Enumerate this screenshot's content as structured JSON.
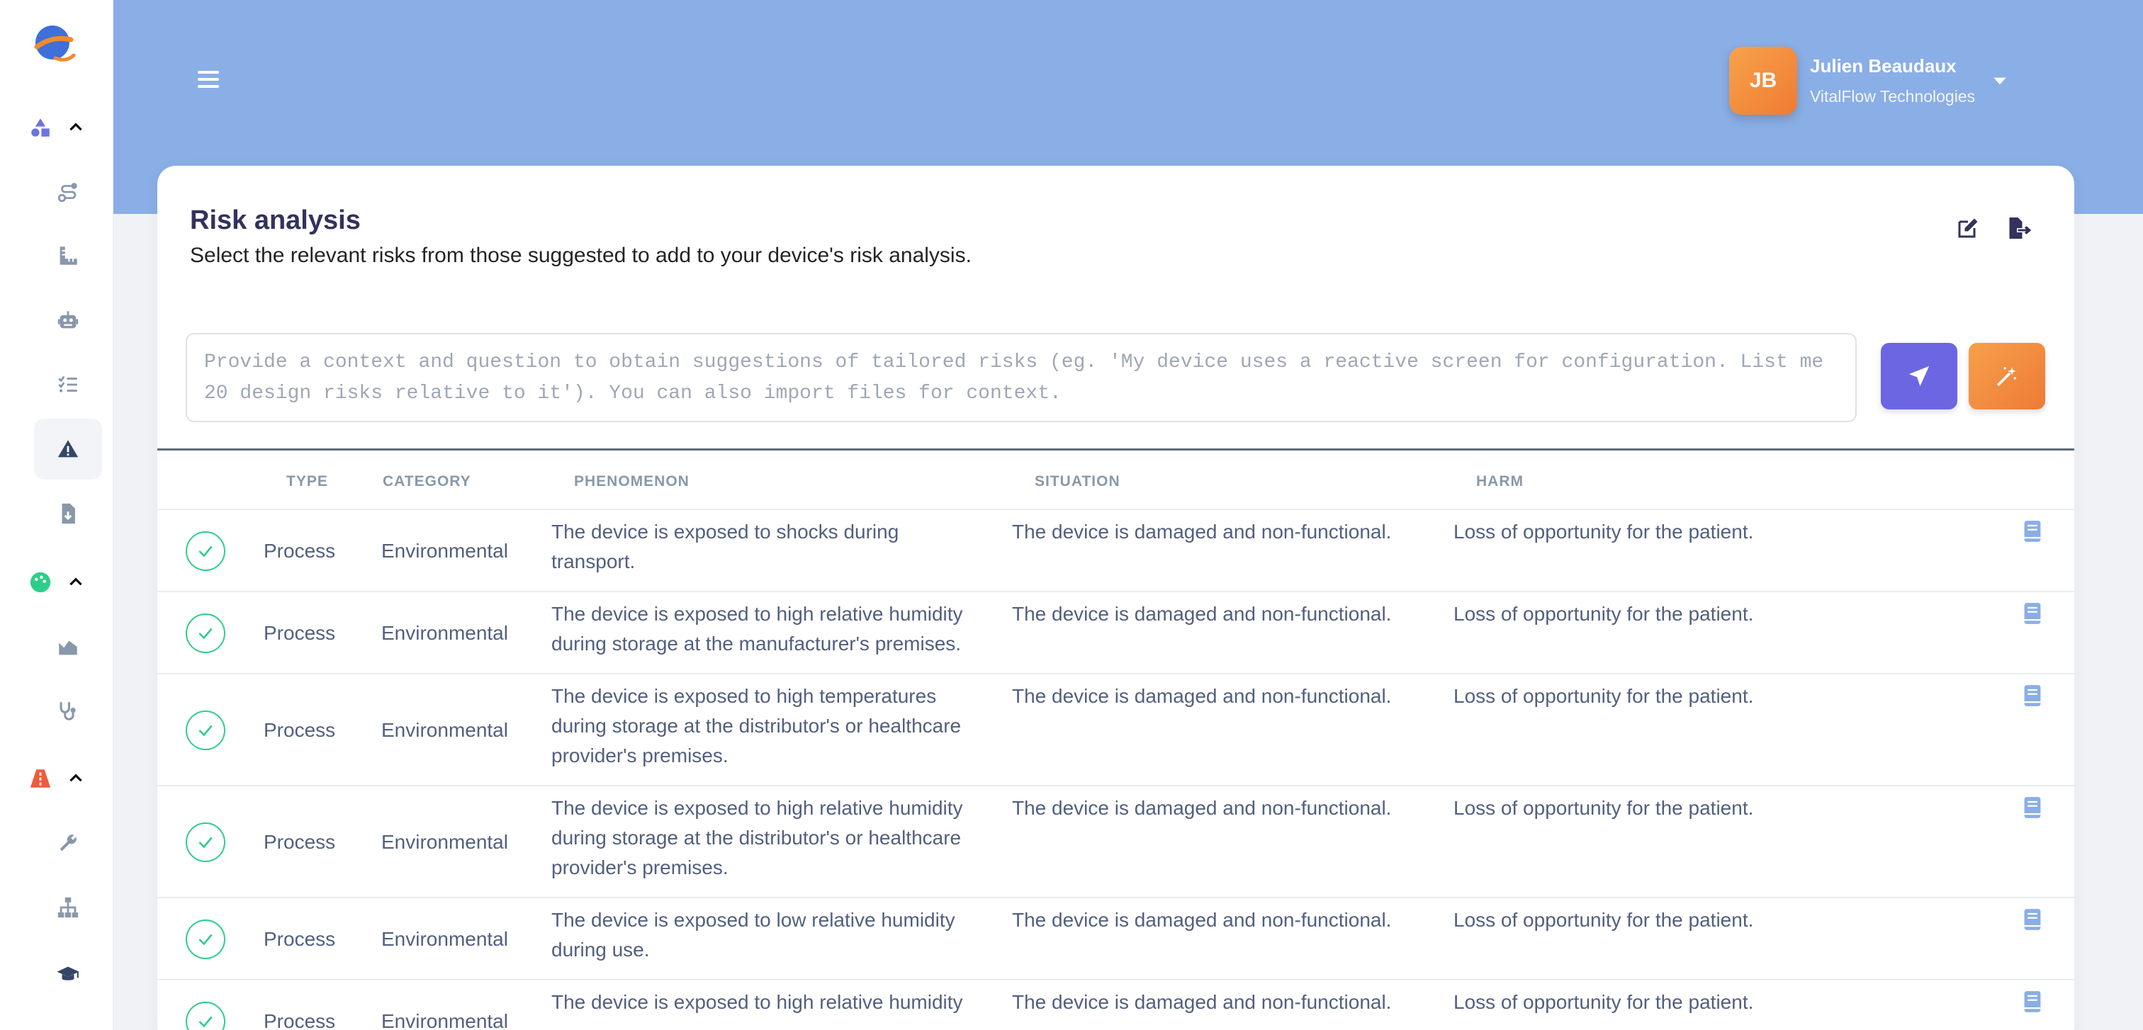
{
  "user": {
    "initials": "JB",
    "name": "Julien Beaudaux",
    "organization": "VitalFlow Technologies"
  },
  "card": {
    "title": "Risk analysis",
    "subtitle": "Select the relevant risks from those suggested to add to your device's risk analysis."
  },
  "prompt": {
    "placeholder": "Provide a context and question to obtain suggestions of tailored risks (eg. 'My device uses a reactive screen for configuration. List me 20 design risks relative to it'). You can also import files for context."
  },
  "table": {
    "headers": {
      "type": "TYPE",
      "category": "CATEGORY",
      "phenomenon": "PHENOMENON",
      "situation": "SITUATION",
      "harm": "HARM"
    },
    "rows": [
      {
        "type": "Process",
        "category": "Environmental",
        "phenomenon_lines": [
          "The device is exposed to shocks during",
          "transport."
        ],
        "situation": "The device is damaged and non-functional.",
        "harm": "Loss of opportunity for the patient."
      },
      {
        "type": "Process",
        "category": "Environmental",
        "phenomenon_lines": [
          "The device is exposed to high relative humidity",
          "during storage at the manufacturer's premises."
        ],
        "situation": "The device is damaged and non-functional.",
        "harm": "Loss of opportunity for the patient."
      },
      {
        "type": "Process",
        "category": "Environmental",
        "phenomenon_lines": [
          "The device is exposed to high temperatures",
          "during storage at the distributor's or healthcare",
          "provider's premises."
        ],
        "situation": "The device is damaged and non-functional.",
        "harm": "Loss of opportunity for the patient."
      },
      {
        "type": "Process",
        "category": "Environmental",
        "phenomenon_lines": [
          "The device is exposed to high relative humidity",
          "during storage at the distributor's or healthcare",
          "provider's premises."
        ],
        "situation": "The device is damaged and non-functional.",
        "harm": "Loss of opportunity for the patient."
      },
      {
        "type": "Process",
        "category": "Environmental",
        "phenomenon_lines": [
          "The device is exposed to low relative humidity",
          "during use."
        ],
        "situation": "The device is damaged and non-functional.",
        "harm": "Loss of opportunity for the patient."
      },
      {
        "type": "Process",
        "category": "Environmental",
        "phenomenon_lines": [
          "The device is exposed to high relative humidity",
          ""
        ],
        "situation": "The device is damaged and non-functional.",
        "harm": "Loss of opportunity for the patient."
      }
    ]
  },
  "colors": {
    "header_bg": "#8aaee6",
    "accent_send": "#6c66e3",
    "accent_orange": "#ef7b32",
    "check_green": "#2dce89",
    "sidebar_blue": "#6c72e0",
    "sidebar_green": "#2dce89",
    "sidebar_red": "#f05a3c"
  },
  "sidebar_icons": [
    "app-logo",
    "shapes-icon",
    "route-icon",
    "ruler-icon",
    "robot-icon",
    "checklist-icon",
    "warning-icon",
    "file-import-icon",
    "palette-icon",
    "chart-area-icon",
    "stethoscope-icon",
    "road-icon",
    "wrench-icon",
    "sitemap-icon",
    "graduation-cap-icon"
  ]
}
